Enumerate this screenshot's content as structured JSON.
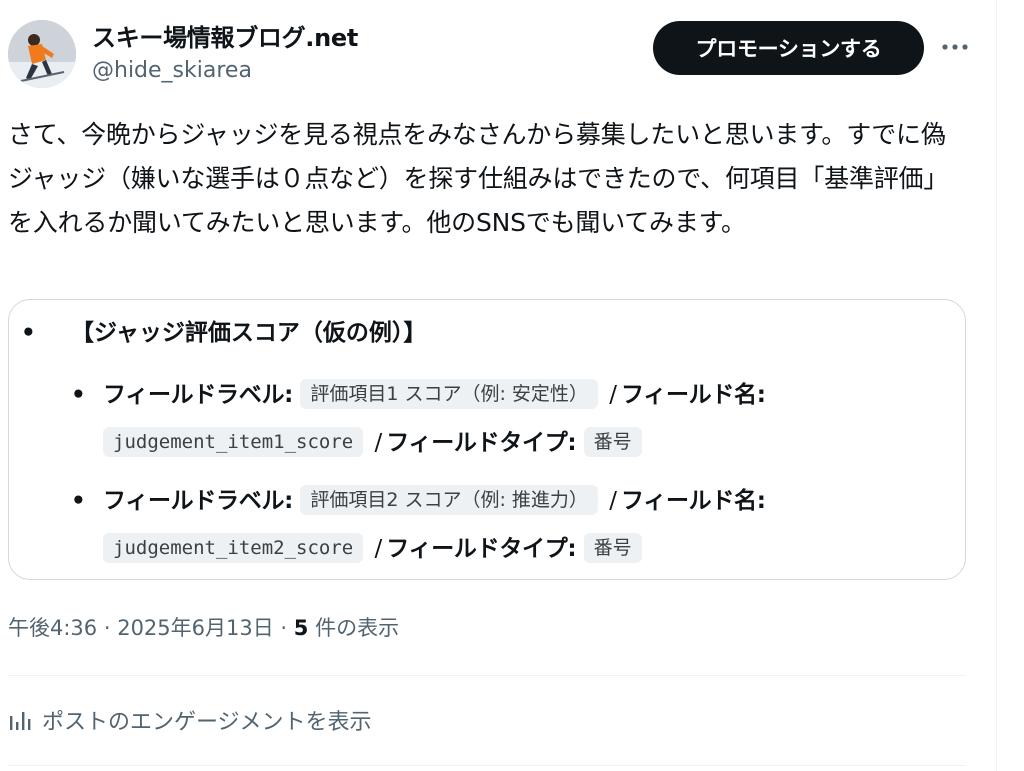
{
  "author": {
    "name": "スキー場情報ブログ.net",
    "handle": "@hide_skiarea",
    "avatar_icon": "skier-avatar"
  },
  "actions": {
    "promote_label": "プロモーションする",
    "more_icon": "more-dots-icon"
  },
  "post": {
    "text": "さて、今晩からジャッジを見る視点をみなさんから募集したいと思います。すでに偽ジャッジ（嫌いな選手は０点など）を探す仕組みはできたので、何項目「基準評価」を入れるか聞いてみたいと思います。他のSNSでも聞いてみます。"
  },
  "card": {
    "bullet": "•",
    "title": "【ジャッジ評価スコア（仮の例）】",
    "items": [
      {
        "bullet": "•",
        "label_key": "フィールドラベル:",
        "label_value": "評価項目1 スコア（例: 安定性）",
        "sep1": "/",
        "name_key": "フィールド名:",
        "name_value": "judgement_item1_score",
        "sep2": "/",
        "type_key": "フィールドタイプ:",
        "type_value": "番号"
      },
      {
        "bullet": "•",
        "label_key": "フィールドラベル:",
        "label_value": "評価項目2 スコア（例: 推進力）",
        "sep1": "/",
        "name_key": "フィールド名:",
        "name_value": "judgement_item2_score",
        "sep2": "/",
        "type_key": "フィールドタイプ:",
        "type_value": "番号"
      }
    ]
  },
  "meta": {
    "time": "午後4:36",
    "dot1": " · ",
    "date": "2025年6月13日",
    "dot2": " · ",
    "views_count": "5",
    "views_label": " 件の表示"
  },
  "engagement": {
    "icon": "bar-chart-icon",
    "label": "ポストのエンゲージメントを表示"
  }
}
